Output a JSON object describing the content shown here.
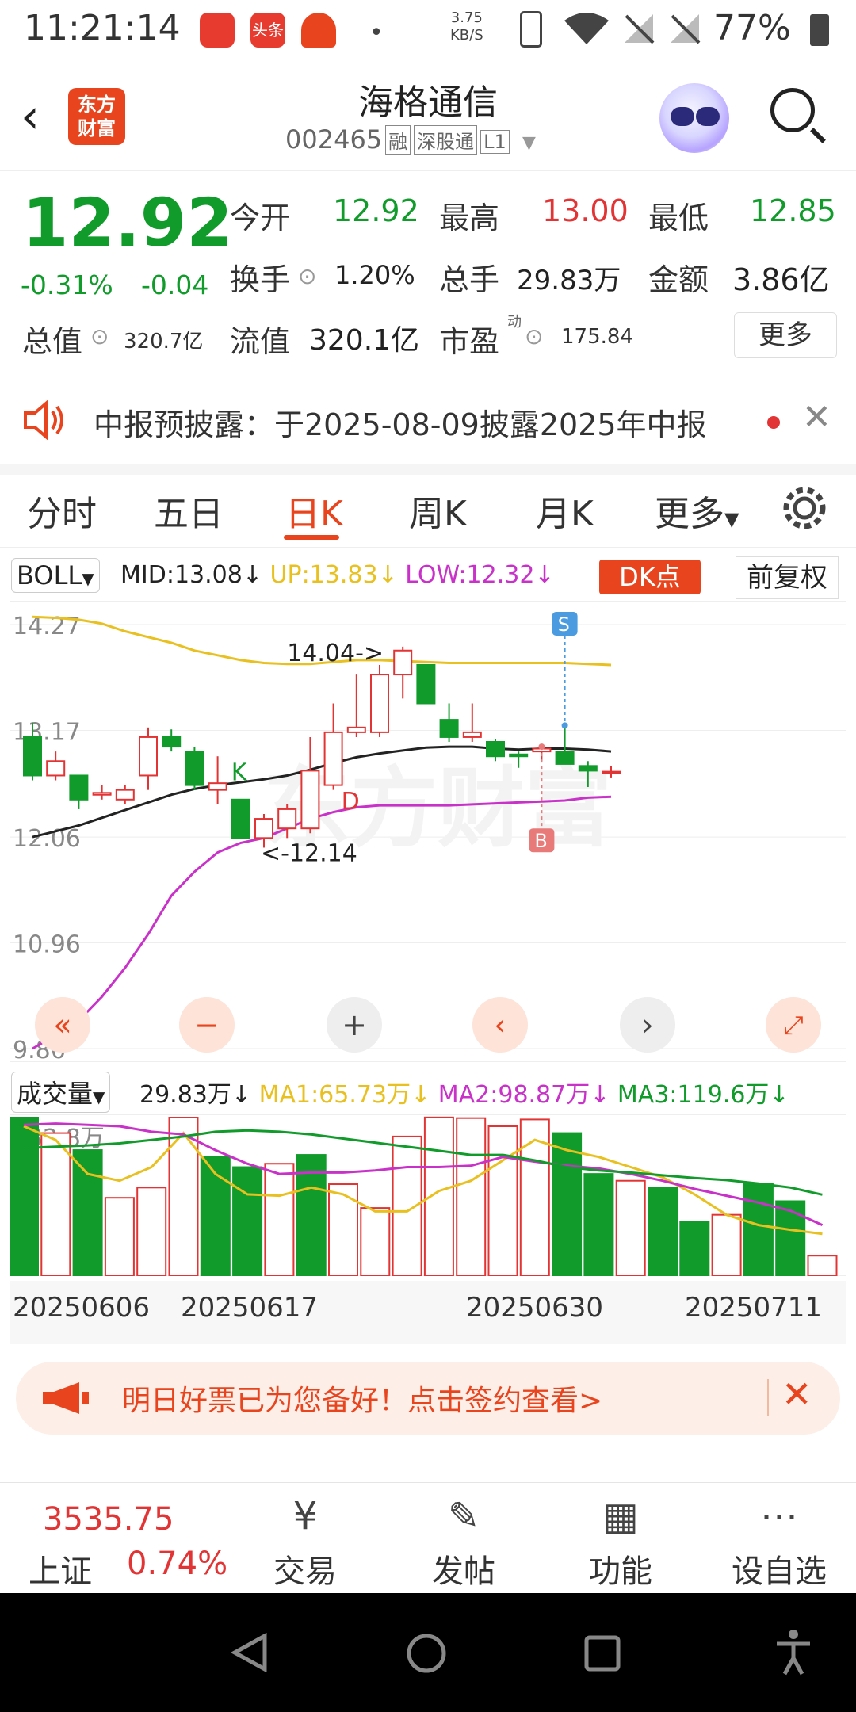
{
  "status": {
    "time": "11:21:14",
    "speed_value": "3.75",
    "speed_unit": "KB/S",
    "battery": "77%"
  },
  "header": {
    "back": "‹",
    "app_logo_line1": "东方",
    "app_logo_line2": "财富",
    "stock_name": "海格通信",
    "stock_code": "002465",
    "tags": [
      "融",
      "深股通",
      "L1"
    ]
  },
  "quote": {
    "price": "12.92",
    "change_pct": "-0.31%",
    "change_amt": "-0.04",
    "open_label": "今开",
    "open": "12.92",
    "high_label": "最高",
    "high": "13.00",
    "low_label": "最低",
    "low": "12.85",
    "turnover_label": "换手",
    "turnover": "1.20%",
    "volume_label": "总手",
    "volume": "29.83万",
    "amount_label": "金额",
    "amount": "3.86亿",
    "mktcap_label": "总值",
    "mktcap": "320.7亿",
    "float_label": "流值",
    "float": "320.1亿",
    "pe_label": "市盈",
    "pe_sup": "动",
    "pe": "175.84",
    "more": "更多"
  },
  "notice": {
    "text": "中报预披露：于2025-08-09披露2025年中报"
  },
  "tabs": [
    "分时",
    "五日",
    "日K",
    "周K",
    "月K",
    "更多"
  ],
  "active_tab": "日K",
  "indicator": {
    "name": "BOLL",
    "mid": "MID:13.08",
    "up": "UP:13.83",
    "low": "LOW:12.32",
    "arrow": "↓",
    "dk": "DK点",
    "adjust": "前复权"
  },
  "colors": {
    "up": "#e23434",
    "down": "#109b2b",
    "accent": "#e8451e",
    "mid_line": "#222222",
    "up_line": "#e8c020",
    "low_line": "#c832c8"
  },
  "chart_data": {
    "type": "candlestick",
    "y_ticks": [
      "14.27",
      "13.17",
      "12.06",
      "10.96",
      "9.86"
    ],
    "ylim": [
      9.86,
      14.27
    ],
    "annotations": {
      "high_mark": "14.04->",
      "low_mark": "<-12.14",
      "k": "K",
      "d": "D",
      "s": "S",
      "b": "B"
    },
    "candles": [
      {
        "o": 13.1,
        "h": 13.25,
        "l": 12.65,
        "c": 12.7
      },
      {
        "o": 12.7,
        "h": 12.95,
        "l": 12.65,
        "c": 12.85
      },
      {
        "o": 12.7,
        "h": 12.7,
        "l": 12.35,
        "c": 12.45
      },
      {
        "o": 12.5,
        "h": 12.6,
        "l": 12.45,
        "c": 12.52
      },
      {
        "o": 12.45,
        "h": 12.6,
        "l": 12.4,
        "c": 12.55
      },
      {
        "o": 12.7,
        "h": 13.2,
        "l": 12.55,
        "c": 13.1
      },
      {
        "o": 13.1,
        "h": 13.18,
        "l": 12.95,
        "c": 13.0
      },
      {
        "o": 12.95,
        "h": 13.0,
        "l": 12.55,
        "c": 12.6
      },
      {
        "o": 12.55,
        "h": 12.9,
        "l": 12.4,
        "c": 12.62
      },
      {
        "o": 12.45,
        "h": 12.45,
        "l": 12.05,
        "c": 12.05
      },
      {
        "o": 12.05,
        "h": 12.3,
        "l": 11.95,
        "c": 12.25
      },
      {
        "o": 12.15,
        "h": 12.4,
        "l": 12.05,
        "c": 12.35
      },
      {
        "o": 12.15,
        "h": 13.1,
        "l": 12.1,
        "c": 12.75
      },
      {
        "o": 12.6,
        "h": 13.45,
        "l": 12.55,
        "c": 13.15
      },
      {
        "o": 13.15,
        "h": 13.75,
        "l": 13.1,
        "c": 13.2
      },
      {
        "o": 13.15,
        "h": 13.85,
        "l": 13.1,
        "c": 13.75
      },
      {
        "o": 13.75,
        "h": 14.04,
        "l": 13.5,
        "c": 14.0
      },
      {
        "o": 13.85,
        "h": 13.85,
        "l": 13.45,
        "c": 13.45
      },
      {
        "o": 13.28,
        "h": 13.45,
        "l": 13.05,
        "c": 13.1
      },
      {
        "o": 13.1,
        "h": 13.45,
        "l": 13.05,
        "c": 13.15
      },
      {
        "o": 13.05,
        "h": 13.08,
        "l": 12.85,
        "c": 12.9
      },
      {
        "o": 12.92,
        "h": 12.95,
        "l": 12.78,
        "c": 12.9
      },
      {
        "o": 12.95,
        "h": 13.0,
        "l": 12.85,
        "c": 12.98
      },
      {
        "o": 12.95,
        "h": 13.22,
        "l": 12.88,
        "c": 12.82
      },
      {
        "o": 12.8,
        "h": 12.85,
        "l": 12.58,
        "c": 12.75
      },
      {
        "o": 12.74,
        "h": 12.8,
        "l": 12.68,
        "c": 12.74
      }
    ],
    "mid_line": [
      12.06,
      12.12,
      12.18,
      12.26,
      12.34,
      12.42,
      12.5,
      12.56,
      12.6,
      12.63,
      12.66,
      12.7,
      12.76,
      12.83,
      12.89,
      12.93,
      12.96,
      12.99,
      13.0,
      13.0,
      12.98,
      12.97,
      12.98,
      12.98,
      12.97,
      12.95
    ],
    "up_line": [
      14.35,
      14.34,
      14.32,
      14.28,
      14.2,
      14.14,
      14.08,
      14.0,
      13.95,
      13.9,
      13.87,
      13.86,
      13.86,
      13.88,
      13.9,
      13.9,
      13.89,
      13.88,
      13.87,
      13.87,
      13.87,
      13.87,
      13.87,
      13.87,
      13.86,
      13.85
    ],
    "low_line": [
      9.86,
      10.0,
      10.15,
      10.4,
      10.7,
      11.05,
      11.45,
      11.7,
      11.9,
      12.0,
      12.05,
      12.15,
      12.25,
      12.32,
      12.37,
      12.39,
      12.39,
      12.39,
      12.39,
      12.4,
      12.41,
      12.42,
      12.43,
      12.44,
      12.47,
      12.48
    ]
  },
  "volume": {
    "label": "成交量",
    "value": "29.83万",
    "arrow": "↓",
    "ma1": "MA1:65.73万",
    "ma2": "MA2:98.87万",
    "ma3": "MA3:119.6万",
    "max_label": "232.8万",
    "bars": [
      232.8,
      210,
      185,
      115,
      130,
      232.8,
      175,
      160,
      165,
      178,
      135,
      100,
      205,
      233,
      232,
      220,
      230,
      210,
      150,
      140,
      130,
      80,
      90,
      135,
      110,
      30
    ],
    "ma1_line": [
      220,
      200,
      150,
      140,
      160,
      210,
      150,
      120,
      118,
      130,
      120,
      95,
      95,
      125,
      140,
      170,
      200,
      185,
      175,
      160,
      145,
      120,
      90,
      75,
      68,
      62
    ],
    "ma2_line": [
      222,
      224,
      222,
      220,
      212,
      208,
      185,
      165,
      150,
      152,
      152,
      155,
      160,
      160,
      162,
      175,
      168,
      162,
      158,
      150,
      140,
      128,
      118,
      108,
      96,
      75
    ],
    "ma3_line": [
      188,
      190,
      192,
      195,
      200,
      205,
      212,
      214,
      212,
      208,
      202,
      196,
      190,
      184,
      178,
      178,
      170,
      160,
      155,
      152,
      148,
      144,
      141,
      136,
      130,
      119.6
    ]
  },
  "dates": [
    "20250606",
    "20250617",
    "20250630",
    "20250711"
  ],
  "banner": {
    "text": "明日好票已为您备好！点击签约查看>"
  },
  "bottom": {
    "index_value": "3535.75",
    "index_name": "上证",
    "index_change": "0.74%",
    "nav": [
      "交易",
      "发帖",
      "功能",
      "设自选"
    ]
  }
}
